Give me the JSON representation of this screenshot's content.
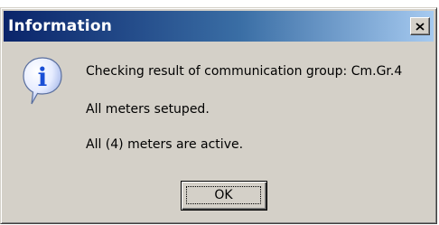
{
  "window": {
    "title": "Information",
    "close_glyph": "close-icon"
  },
  "icon": {
    "name": "information-icon",
    "glyph": "i",
    "color": "#1a4fd6"
  },
  "messages": [
    "Checking result of communication group: Cm.Gr.4",
    "All meters setuped.",
    "All (4) meters are active."
  ],
  "buttons": {
    "ok_label": "OK"
  },
  "colors": {
    "title_gradient_start": "#0a246a",
    "title_gradient_end": "#a6caf0",
    "dialog_face": "#d4d0c8"
  }
}
